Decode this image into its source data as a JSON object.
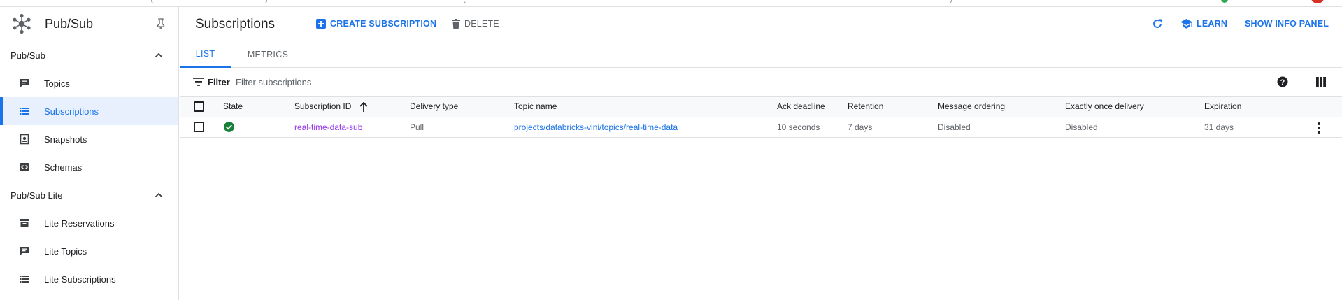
{
  "colors": {
    "accent": "#1a73e8",
    "success": "#188038",
    "visited_link": "#9334e6"
  },
  "sidebar": {
    "product_name": "Pub/Sub",
    "sections": [
      {
        "label": "Pub/Sub",
        "items": [
          {
            "label": "Topics",
            "icon": "message-icon",
            "active": false
          },
          {
            "label": "Subscriptions",
            "icon": "list-icon",
            "active": true
          },
          {
            "label": "Snapshots",
            "icon": "snapshot-icon",
            "active": false
          },
          {
            "label": "Schemas",
            "icon": "code-icon",
            "active": false
          }
        ]
      },
      {
        "label": "Pub/Sub Lite",
        "items": [
          {
            "label": "Lite Reservations",
            "icon": "reservation-icon",
            "active": false
          },
          {
            "label": "Lite Topics",
            "icon": "message-icon",
            "active": false
          },
          {
            "label": "Lite Subscriptions",
            "icon": "list-icon",
            "active": false
          }
        ]
      }
    ]
  },
  "header": {
    "title": "Subscriptions",
    "create_label": "CREATE SUBSCRIPTION",
    "delete_label": "DELETE",
    "learn_label": "LEARN",
    "info_panel_label": "SHOW INFO PANEL"
  },
  "tabs": [
    {
      "label": "LIST",
      "active": true
    },
    {
      "label": "METRICS",
      "active": false
    }
  ],
  "filter": {
    "label": "Filter",
    "placeholder": "Filter subscriptions"
  },
  "table": {
    "columns": [
      "State",
      "Subscription ID",
      "Delivery type",
      "Topic name",
      "Ack deadline",
      "Retention",
      "Message ordering",
      "Exactly once delivery",
      "Expiration"
    ],
    "rows": [
      {
        "state": "success",
        "subscription_id": "real-time-data-sub",
        "delivery_type": "Pull",
        "topic_name": "projects/databricks-vini/topics/real-time-data",
        "ack_deadline": "10 seconds",
        "retention": "7 days",
        "message_ordering": "Disabled",
        "exactly_once_delivery": "Disabled",
        "expiration": "31 days"
      }
    ]
  }
}
